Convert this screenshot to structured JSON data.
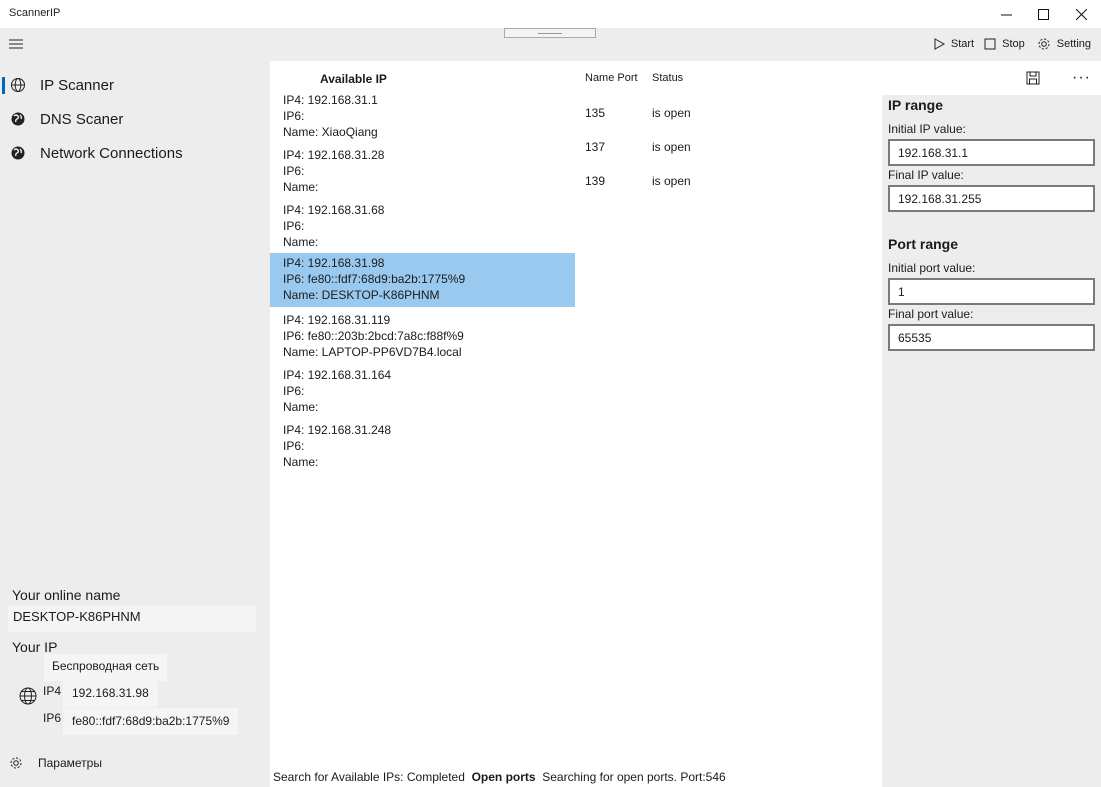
{
  "app": {
    "title": "ScannerIP"
  },
  "toolbar": {
    "start_label": "Start",
    "stop_label": "Stop",
    "setting_label": "Setting"
  },
  "nav": {
    "items": [
      {
        "label": "IP Scanner",
        "icon": "globe-icon",
        "active": true
      },
      {
        "label": "DNS Scaner",
        "icon": "globe-filled-icon",
        "active": false
      },
      {
        "label": "Network Connections",
        "icon": "globe-filled-icon",
        "active": false
      }
    ],
    "settings_label": "Параметры"
  },
  "sidebar": {
    "online_name_label": "Your online name",
    "online_name": "DESKTOP-K86PHNM",
    "your_ip_label": "Your IP",
    "adapter": "Беспроводная сеть",
    "ip4_label": "IP4",
    "ip4_value": "192.168.31.98",
    "ip6_label": "IP6",
    "ip6_value": "fe80::fdf7:68d9:ba2b:1775%9"
  },
  "list": {
    "header": "Available IP",
    "items": [
      {
        "ip4": "IP4: 192.168.31.1",
        "ip6": "IP6:",
        "name": "Name: XiaoQiang"
      },
      {
        "ip4": "IP4: 192.168.31.28",
        "ip6": "IP6:",
        "name": "Name:"
      },
      {
        "ip4": "IP4: 192.168.31.68",
        "ip6": "IP6:",
        "name": "Name:"
      },
      {
        "ip4": "IP4: 192.168.31.98",
        "ip6": "IP6: fe80::fdf7:68d9:ba2b:1775%9",
        "name": "Name: DESKTOP-K86PHNM",
        "selected": true
      },
      {
        "ip4": "IP4: 192.168.31.119",
        "ip6": "IP6: fe80::203b:2bcd:7a8c:f88f%9",
        "name": "Name: LAPTOP-PP6VD7B4.local"
      },
      {
        "ip4": "IP4: 192.168.31.164",
        "ip6": "IP6:",
        "name": "Name:"
      },
      {
        "ip4": "IP4: 192.168.31.248",
        "ip6": "IP6:",
        "name": "Name:"
      }
    ]
  },
  "ports": {
    "header_name": "Name Port",
    "header_status": "Status",
    "rows": [
      {
        "port": "135",
        "status": "is open"
      },
      {
        "port": "137",
        "status": "is open"
      },
      {
        "port": "139",
        "status": "is open"
      }
    ]
  },
  "statusbar": {
    "search": "Search for Available IPs: Completed",
    "open_ports": "Open ports",
    "progress": "Searching for open ports. Port:546"
  },
  "ip_range": {
    "title": "IP range",
    "initial_label": "Initial IP value:",
    "initial_value": "192.168.31.1",
    "final_label": "Final IP value:",
    "final_value": "192.168.31.255"
  },
  "port_range": {
    "title": "Port range",
    "initial_label": "Initial port value:",
    "initial_value": "1",
    "final_label": "Final port value:",
    "final_value": "65535"
  },
  "colors": {
    "accent": "#0067c0",
    "selection": "#99c9ef"
  }
}
